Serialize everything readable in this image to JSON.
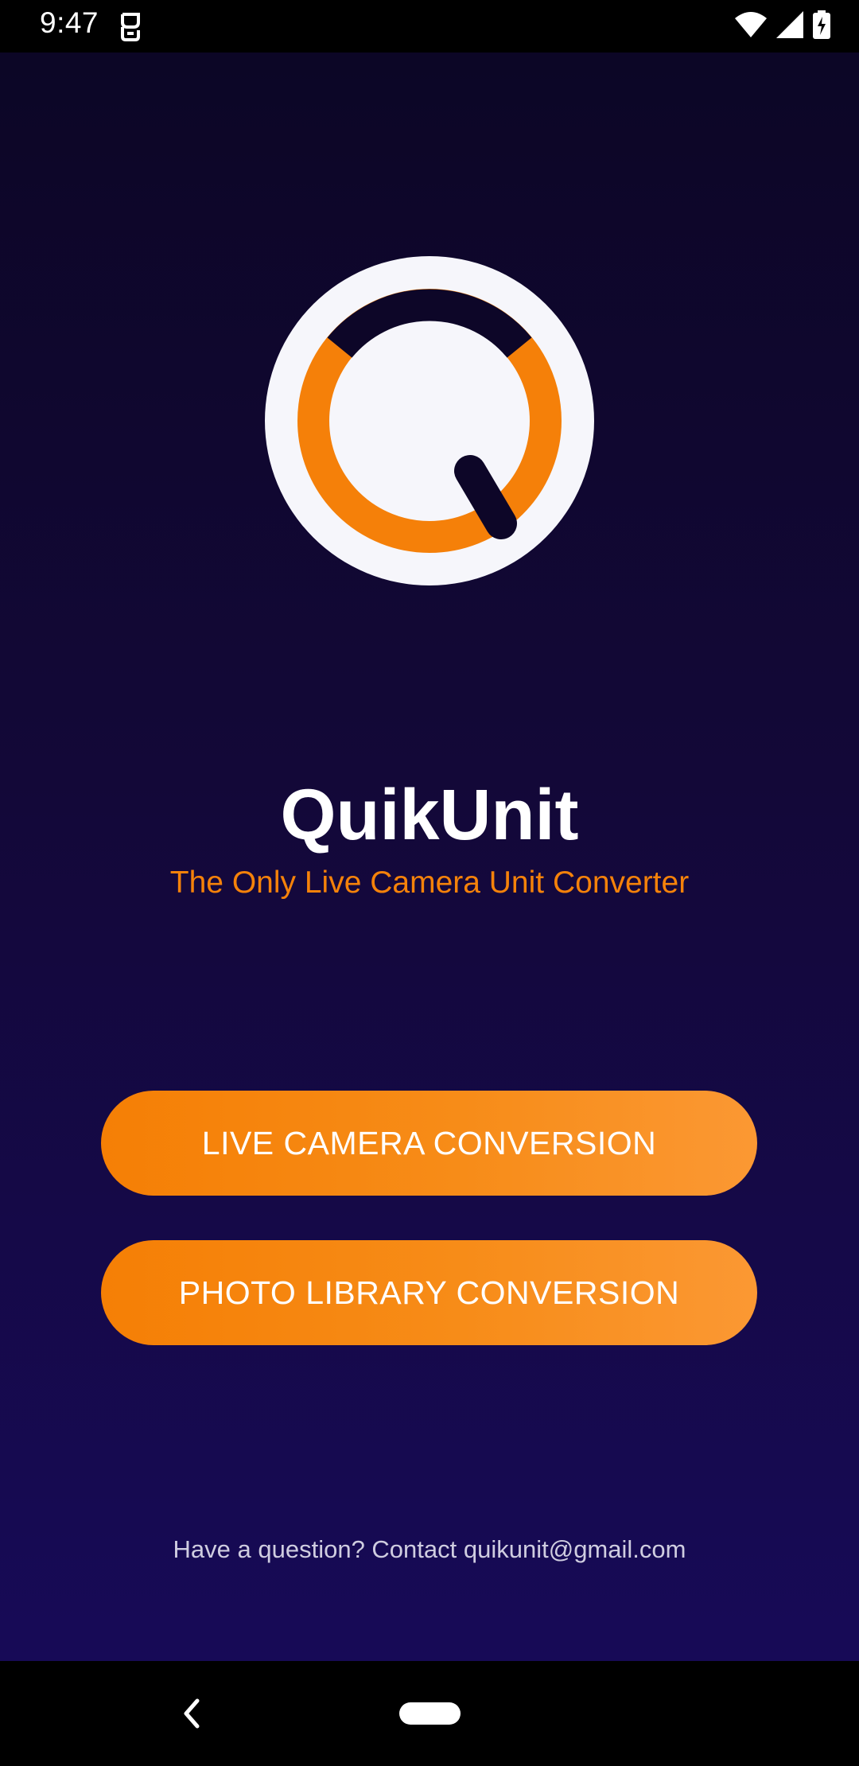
{
  "status_bar": {
    "time": "9:47",
    "icons": [
      "notification-icon",
      "wifi-icon",
      "signal-icon",
      "battery-charging-icon"
    ]
  },
  "app": {
    "title": "QuikUnit",
    "subtitle": "The Only Live Camera Unit Converter",
    "logo": "quikunit-logo",
    "buttons": {
      "live_camera": "LIVE CAMERA CONVERSION",
      "photo_library": "PHOTO LIBRARY CONVERSION"
    },
    "contact_text": "Have a question? Contact quikunit@gmail.com"
  },
  "colors": {
    "background_top": "#0c0626",
    "background_bottom": "#170a57",
    "accent": "#f57f05",
    "title": "#ffffff",
    "logo_ring": "#f58009",
    "logo_dark": "#0d0628",
    "logo_face": "#f6f6fb"
  },
  "nav_bar": {
    "icons": [
      "back-icon",
      "home-pill-icon"
    ]
  }
}
